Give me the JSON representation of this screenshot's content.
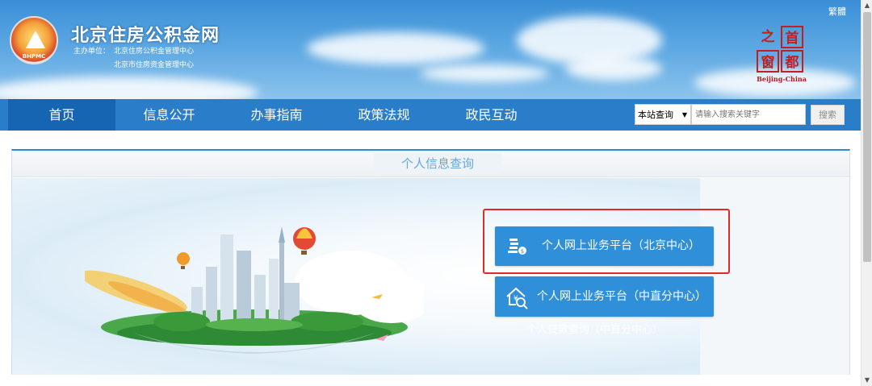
{
  "header": {
    "site_title": "北京住房公积金网",
    "sponsor_label": "主办单位：",
    "sponsor_1": "北京住房公积金管理中心",
    "sponsor_2": "北京市住房资金管理中心",
    "logo_abbr": "BHPMC",
    "traditional_link": "繁體",
    "capital_logo": {
      "chars": [
        "之",
        "首",
        "窗",
        "都"
      ],
      "english": "Beijing-China"
    }
  },
  "nav": {
    "items": [
      {
        "label": "首页",
        "active": true
      },
      {
        "label": "信息公开",
        "active": false
      },
      {
        "label": "办事指南",
        "active": false
      },
      {
        "label": "政策法规",
        "active": false
      },
      {
        "label": "政民互动",
        "active": false
      }
    ]
  },
  "search": {
    "scope": "本站查询",
    "placeholder": "请输入搜索关键字",
    "button": "搜索"
  },
  "panel": {
    "title": "个人信息查询",
    "buttons": [
      {
        "label": "个人网上业务平台（北京中心）",
        "icon": "coin-stack-icon",
        "highlighted": true
      },
      {
        "label": "个人网上业务平台（中直分中心）",
        "icon": "house-search-icon",
        "highlighted": false
      }
    ],
    "faded_text": "个人贷款查询（中直分中心）"
  },
  "colors": {
    "nav_bg": "#2a7ec9",
    "nav_active": "#1665b3",
    "button_bg": "#2f8fd8",
    "highlight_border": "#e02a2a",
    "seal_red": "#c41e1e"
  }
}
